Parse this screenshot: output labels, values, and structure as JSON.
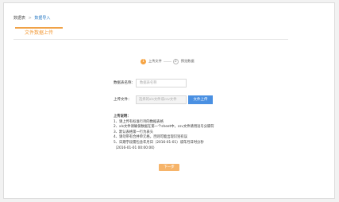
{
  "breadcrumb": {
    "parent": "数据表",
    "separator": ">",
    "current": "数据导入"
  },
  "tab": {
    "label": "文件数据上传"
  },
  "steps": [
    {
      "number": "1",
      "label": "上传文件"
    },
    {
      "number": "2",
      "label": "预览数据"
    }
  ],
  "form": {
    "table_name_label": "数据表名称：",
    "table_name_placeholder": "数据表名称",
    "file_label": "上传文件：",
    "file_placeholder": "选择的xls文件或csv文件",
    "upload_button": "文件上传"
  },
  "instructions": {
    "title": "上传说明：",
    "items": [
      "1、请上传有标准行列的数据表格",
      "2、xls文件请确保数据在第一个sheet中，csv文件请用逗号分隔符",
      "3、默认表格第一行为表头",
      "4、请勿带有合并单元格，否则可能出现识别有误",
      "5、日期字段需包含年月日（2016-01-01）或年月日时分秒",
      "（2016-01-01 00:00:00）"
    ]
  },
  "next_button": "下一步",
  "colors": {
    "accent_orange": "#f6a443",
    "primary_blue": "#4a90e2",
    "link_blue": "#2f7ec6"
  }
}
